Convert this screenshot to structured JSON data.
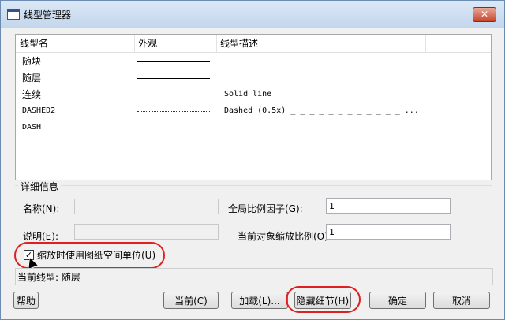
{
  "window": {
    "title": "线型管理器",
    "close_label": "✕"
  },
  "list": {
    "headers": [
      "线型名",
      "外观",
      "线型描述"
    ],
    "rows": [
      {
        "name": "随块",
        "description": ""
      },
      {
        "name": "随层",
        "description": ""
      },
      {
        "name": "连续",
        "description": "Solid line"
      },
      {
        "name": "DASHED2",
        "description": "Dashed (0.5x) _ _ _ _ _ _ _ _ _ _ _ _ ..."
      },
      {
        "name": "DASH",
        "description": ""
      }
    ]
  },
  "details": {
    "group_label": "详细信息",
    "name_label": "名称(N):",
    "name_value": "",
    "desc_label": "说明(E):",
    "desc_value": "",
    "global_scale_label": "全局比例因子(G):",
    "global_scale_value": "1",
    "object_scale_label": "当前对象缩放比例(O):",
    "object_scale_value": "1",
    "paper_units_label": "缩放时使用图纸空间单位(U)",
    "paper_units_checked": "✓"
  },
  "status": {
    "text": "当前线型: 随层"
  },
  "buttons": {
    "help": "帮助",
    "current": "当前(C)",
    "load": "加载(L)...",
    "hide_details": "隐藏细节(H)",
    "ok": "确定",
    "cancel": "取消"
  }
}
